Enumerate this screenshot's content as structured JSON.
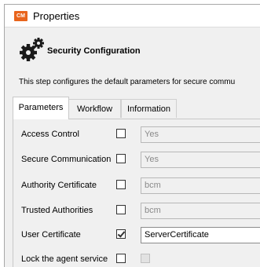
{
  "window": {
    "app_icon_text": "CM",
    "title": "Properties"
  },
  "header": {
    "title": "Security Configuration",
    "description": "This step configures the default parameters for secure commu"
  },
  "tabs": [
    {
      "label": "Parameters",
      "active": true
    },
    {
      "label": "Workflow",
      "active": false
    },
    {
      "label": "Information",
      "active": false
    }
  ],
  "fields": [
    {
      "label": "Access Control",
      "checked": false,
      "value": "Yes",
      "enabled": false
    },
    {
      "label": "Secure Communication",
      "checked": false,
      "value": "Yes",
      "enabled": false
    },
    {
      "label": "Authority Certificate",
      "checked": false,
      "value": "bcm",
      "enabled": false
    },
    {
      "label": "Trusted Authorities",
      "checked": false,
      "value": "bcm",
      "enabled": false
    },
    {
      "label": "User Certificate",
      "checked": true,
      "value": "ServerCertificate",
      "enabled": true
    },
    {
      "label": "Lock the agent service",
      "checked": false,
      "value": "",
      "enabled": false
    }
  ],
  "colors": {
    "app_icon": "#e8641c",
    "window_bg": "#f0f0f0"
  },
  "icons": [
    "gear-icon"
  ]
}
